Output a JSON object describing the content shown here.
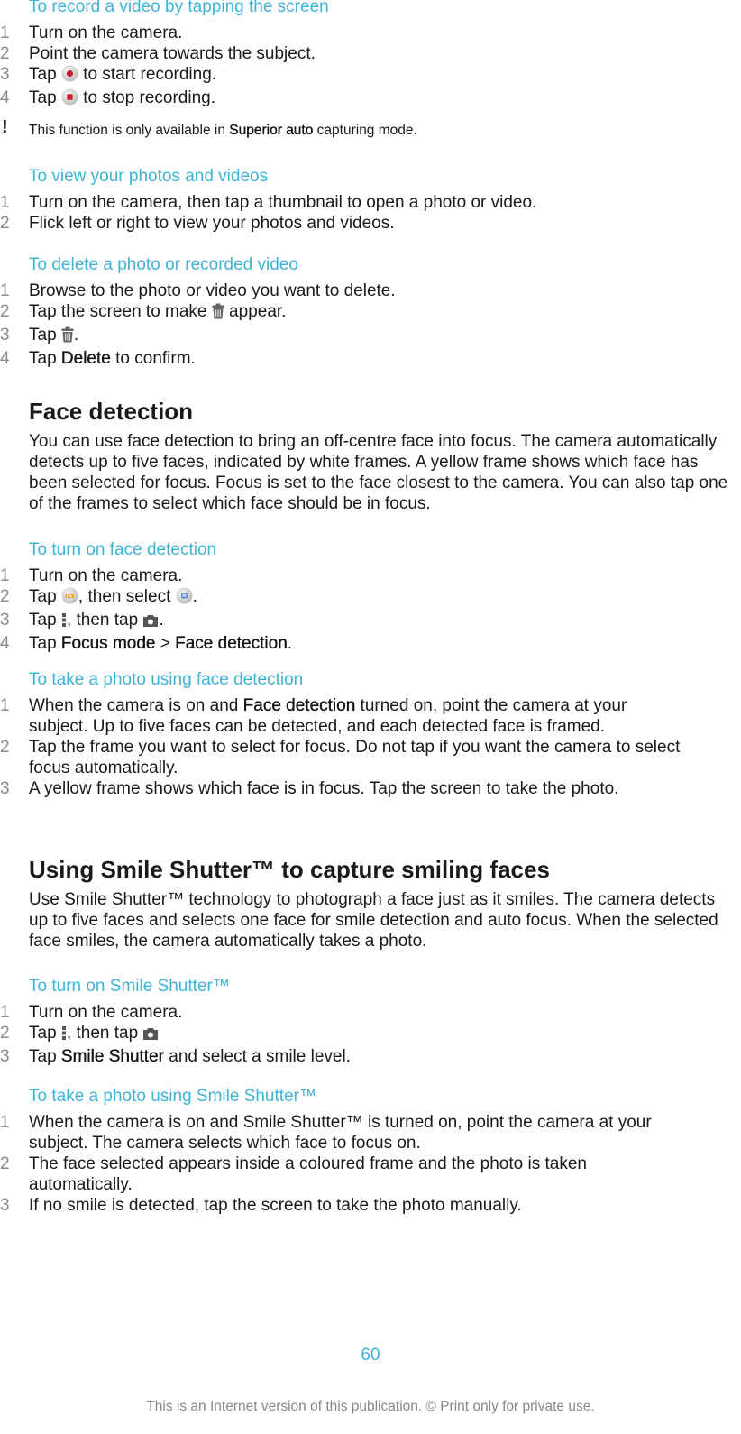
{
  "section_record": {
    "title": "To record a video by tapping the screen",
    "steps": [
      {
        "n": "1",
        "a": "Turn on the camera."
      },
      {
        "n": "2",
        "a": "Point the camera towards the subject."
      },
      {
        "n": "3",
        "a": "Tap ",
        "icon": "record-start-icon",
        "b": " to start recording."
      },
      {
        "n": "4",
        "a": "Tap ",
        "icon": "record-stop-icon",
        "b": " to stop recording."
      }
    ],
    "note": {
      "pre": "This function is only available in ",
      "bold": "Superior auto",
      "post": " capturing mode."
    }
  },
  "section_view": {
    "title": "To view your photos and videos",
    "steps": [
      {
        "n": "1",
        "a": "Turn on the camera, then tap a thumbnail to open a photo or video."
      },
      {
        "n": "2",
        "a": "Flick left or right to view your photos and videos."
      }
    ]
  },
  "section_delete": {
    "title": "To delete a photo or recorded video",
    "steps": [
      {
        "n": "1",
        "a": "Browse to the photo or video you want to delete."
      },
      {
        "n": "2",
        "a": "Tap the screen to make ",
        "icon": "trash-icon",
        "b": " appear."
      },
      {
        "n": "3",
        "a": "Tap ",
        "icon": "trash-icon",
        "b": "."
      },
      {
        "n": "4",
        "a": "Tap ",
        "bold": "Delete",
        "b": " to confirm."
      }
    ]
  },
  "face_detection": {
    "heading": "Face detection",
    "body": "You can use face detection to bring an off-centre face into focus. The camera automatically detects up to five faces, indicated by white frames. A yellow frame shows which face has been selected for focus. Focus is set to the face closest to the camera. You can also tap one of the frames to select which face should be in focus.",
    "turn_on": {
      "title": "To turn on face detection",
      "steps": [
        {
          "n": "1",
          "a": "Turn on the camera."
        },
        {
          "n": "2",
          "a": "Tap ",
          "icon": "camera-mode-icon",
          "b": ", then select ",
          "icon2": "superior-auto-icon",
          "c": "."
        },
        {
          "n": "3",
          "a": "Tap ",
          "icon": "menu-dots-icon",
          "b": ", then tap ",
          "icon2": "camera-icon",
          "c": "."
        },
        {
          "n": "4",
          "a": "Tap ",
          "bold": "Focus mode",
          "b": " > ",
          "bold2": "Face detection",
          "c": "."
        }
      ]
    },
    "take_photo": {
      "title": "To take a photo using face detection",
      "steps": [
        {
          "n": "1",
          "a": "When the camera is on and ",
          "bold": "Face detection",
          "b": " turned on, point the camera at your subject. Up to five faces can be detected, and each detected face is framed."
        },
        {
          "n": "2",
          "a": "Tap the frame you want to select for focus. Do not tap if you want the camera to select focus automatically."
        },
        {
          "n": "3",
          "a": "A yellow frame shows which face is in focus. Tap the screen to take the photo."
        }
      ]
    }
  },
  "smile_shutter": {
    "heading": "Using Smile Shutter™ to capture smiling faces",
    "body": "Use Smile Shutter™ technology to photograph a face just as it smiles. The camera detects up to five faces and selects one face for smile detection and auto focus. When the selected face smiles, the camera automatically takes a photo.",
    "turn_on": {
      "title": "To turn on Smile Shutter™",
      "steps": [
        {
          "n": "1",
          "a": "Turn on the camera."
        },
        {
          "n": "2",
          "a": "Tap ",
          "icon": "menu-dots-icon",
          "b": ", then tap ",
          "icon2": "camera-icon"
        },
        {
          "n": "3",
          "a": "Tap ",
          "bold": "Smile Shutter",
          "b": " and select a smile level."
        }
      ]
    },
    "take_photo": {
      "title": "To take a photo using Smile Shutter™",
      "steps": [
        {
          "n": "1",
          "a": "When the camera is on and Smile Shutter™ is turned on, point the camera at your subject. The camera selects which face to focus on."
        },
        {
          "n": "2",
          "a": "The face selected appears inside a coloured frame and the photo is taken automatically."
        },
        {
          "n": "3",
          "a": "If no smile is detected, tap the screen to take the photo manually."
        }
      ]
    }
  },
  "footer": {
    "page_number": "60",
    "notice": "This is an Internet version of this publication. © Print only for private use."
  },
  "colors": {
    "accent": "#3fb3d6",
    "text": "#1a1a1a",
    "step_number": "#8a8a8a",
    "record_red": "#d0212a"
  }
}
